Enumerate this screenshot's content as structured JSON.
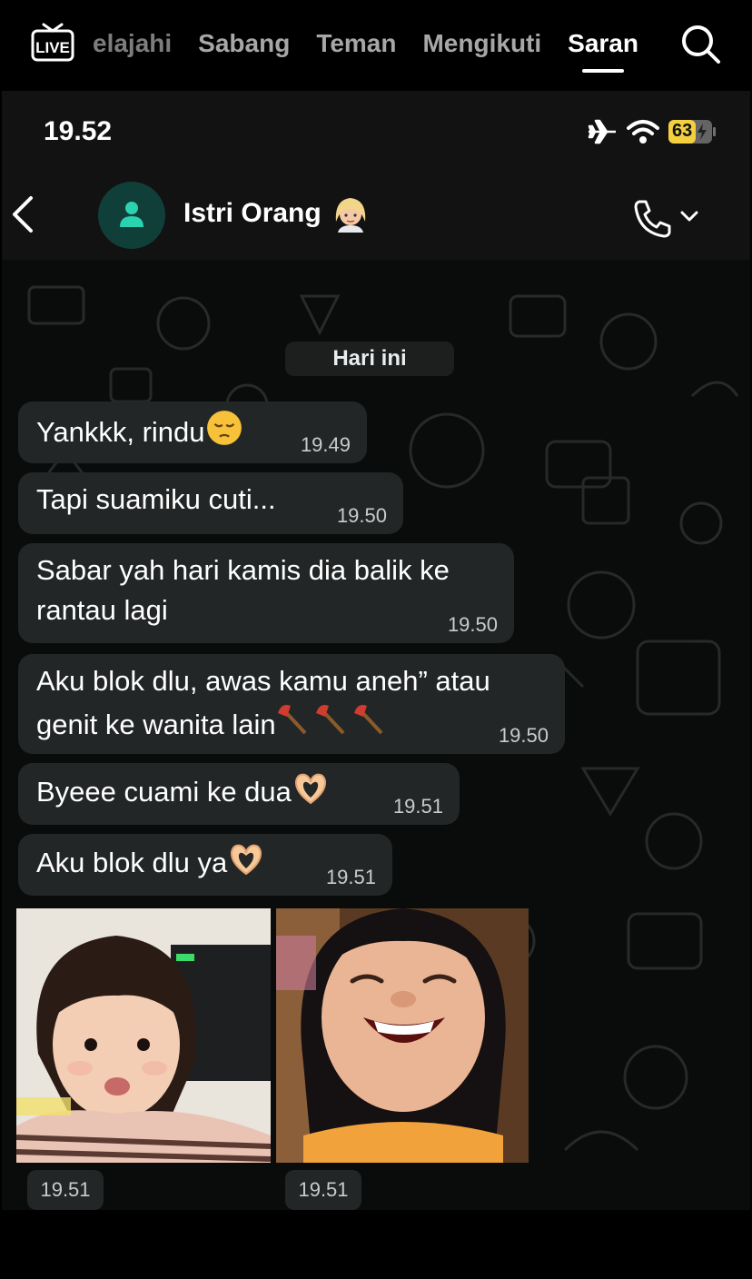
{
  "app_nav": {
    "tabs": [
      "elajahi",
      "Sabang",
      "Teman",
      "Mengikuti",
      "Saran"
    ],
    "active_tab": "Saran",
    "live_label": "LIVE"
  },
  "status_bar": {
    "time": "19.52",
    "battery": "63",
    "battery_level": 0.63,
    "icons": [
      "airplane-icon",
      "wifi-icon",
      "battery-charging-icon"
    ]
  },
  "chat_header": {
    "contact_name": "Istri Orang",
    "contact_emoji": "person-blond-emoji"
  },
  "day_label": "Hari ini",
  "messages": [
    {
      "text": "Yankkk, rindu",
      "emoji": "pensive-face",
      "time": "19.49"
    },
    {
      "text": "Tapi suamiku cuti...",
      "time": "19.50"
    },
    {
      "text": "Sabar yah hari kamis dia balik ke",
      "text2": "rantau lagi",
      "time": "19.50"
    },
    {
      "text": "Aku blok dlu, awas kamu aneh” atau",
      "text2": "genit ke wanita lain",
      "emoji": "axe x3",
      "time": "19.50"
    },
    {
      "text": "Byeee cuami ke dua",
      "emoji": "heart-hands",
      "time": "19.51"
    },
    {
      "text": "Aku blok dlu ya",
      "emoji": "heart-hands",
      "time": "19.51"
    }
  ],
  "media": [
    {
      "time": "19.51"
    },
    {
      "time": "19.51"
    }
  ],
  "colors": {
    "bubble": "#232626",
    "avatar_bg": "#103f3a",
    "avatar_fg": "#2bd2b0",
    "battery": "#f4d03f"
  }
}
